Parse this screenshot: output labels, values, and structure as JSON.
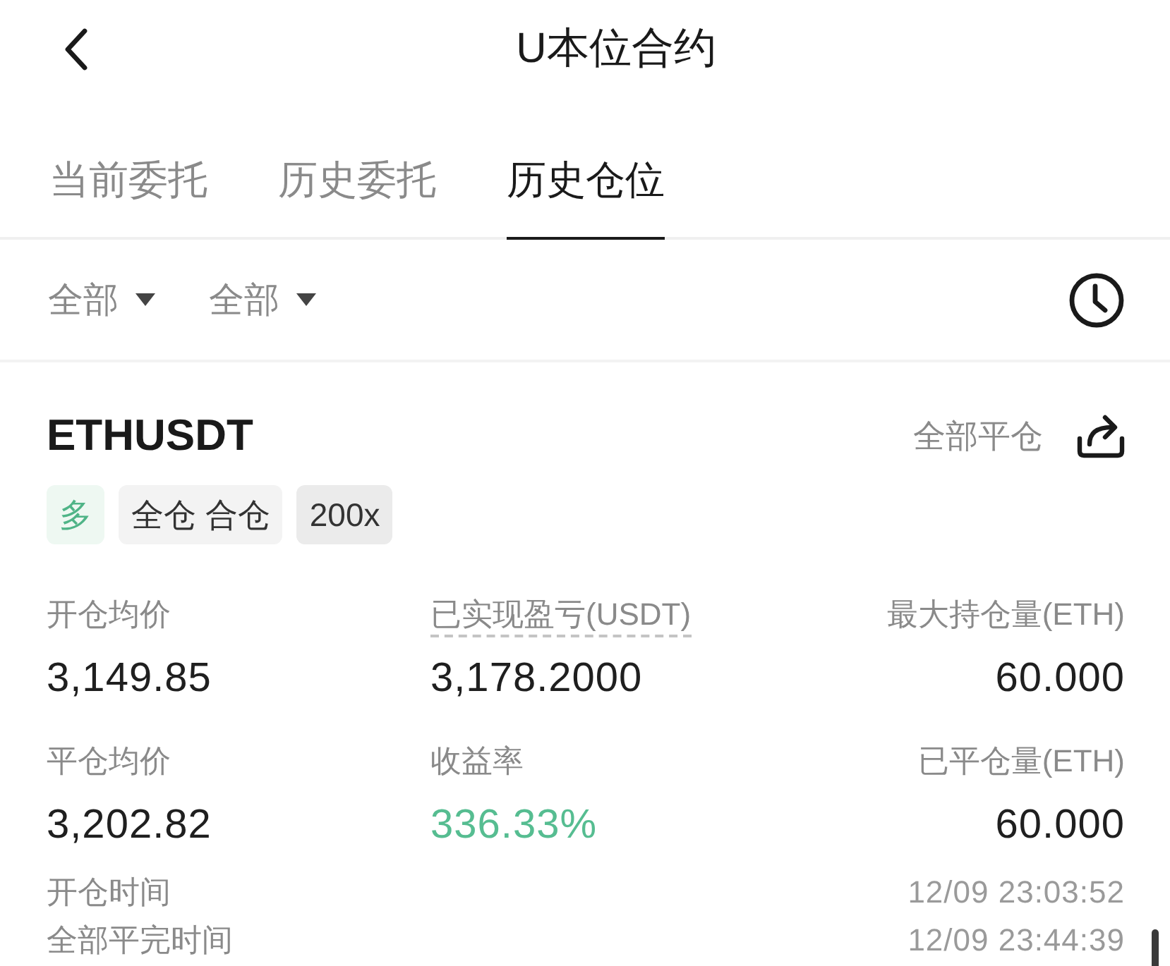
{
  "header": {
    "title": "U本位合约"
  },
  "tabs": [
    {
      "label": "当前委托",
      "selected": false
    },
    {
      "label": "历史委托",
      "selected": false
    },
    {
      "label": "历史仓位",
      "selected": true
    }
  ],
  "filters": [
    {
      "label": "全部"
    },
    {
      "label": "全部"
    }
  ],
  "position": {
    "symbol": "ETHUSDT",
    "close_all": "全部平仓",
    "tags": [
      {
        "label": "多",
        "kind": "side"
      },
      {
        "label": "全仓 合仓",
        "kind": "mode"
      },
      {
        "label": "200x",
        "kind": "leverage"
      }
    ],
    "stats": [
      {
        "label": "开仓均价",
        "value": "3,149.85",
        "has_tooltip": false,
        "highlight": false
      },
      {
        "label": "已实现盈亏(USDT)",
        "value": "3,178.2000",
        "has_tooltip": true,
        "highlight": false
      },
      {
        "label": "最大持仓量(ETH)",
        "value": "60.000",
        "has_tooltip": false,
        "highlight": false
      },
      {
        "label": "平仓均价",
        "value": "3,202.82",
        "has_tooltip": false,
        "highlight": false
      },
      {
        "label": "收益率",
        "value": "336.33%",
        "has_tooltip": false,
        "highlight": true
      },
      {
        "label": "已平仓量(ETH)",
        "value": "60.000",
        "has_tooltip": false,
        "highlight": false
      }
    ],
    "times": [
      {
        "label": "开仓时间",
        "value": "12/09 23:03:52"
      },
      {
        "label": "全部平完时间",
        "value": "12/09 23:44:39"
      }
    ]
  }
}
